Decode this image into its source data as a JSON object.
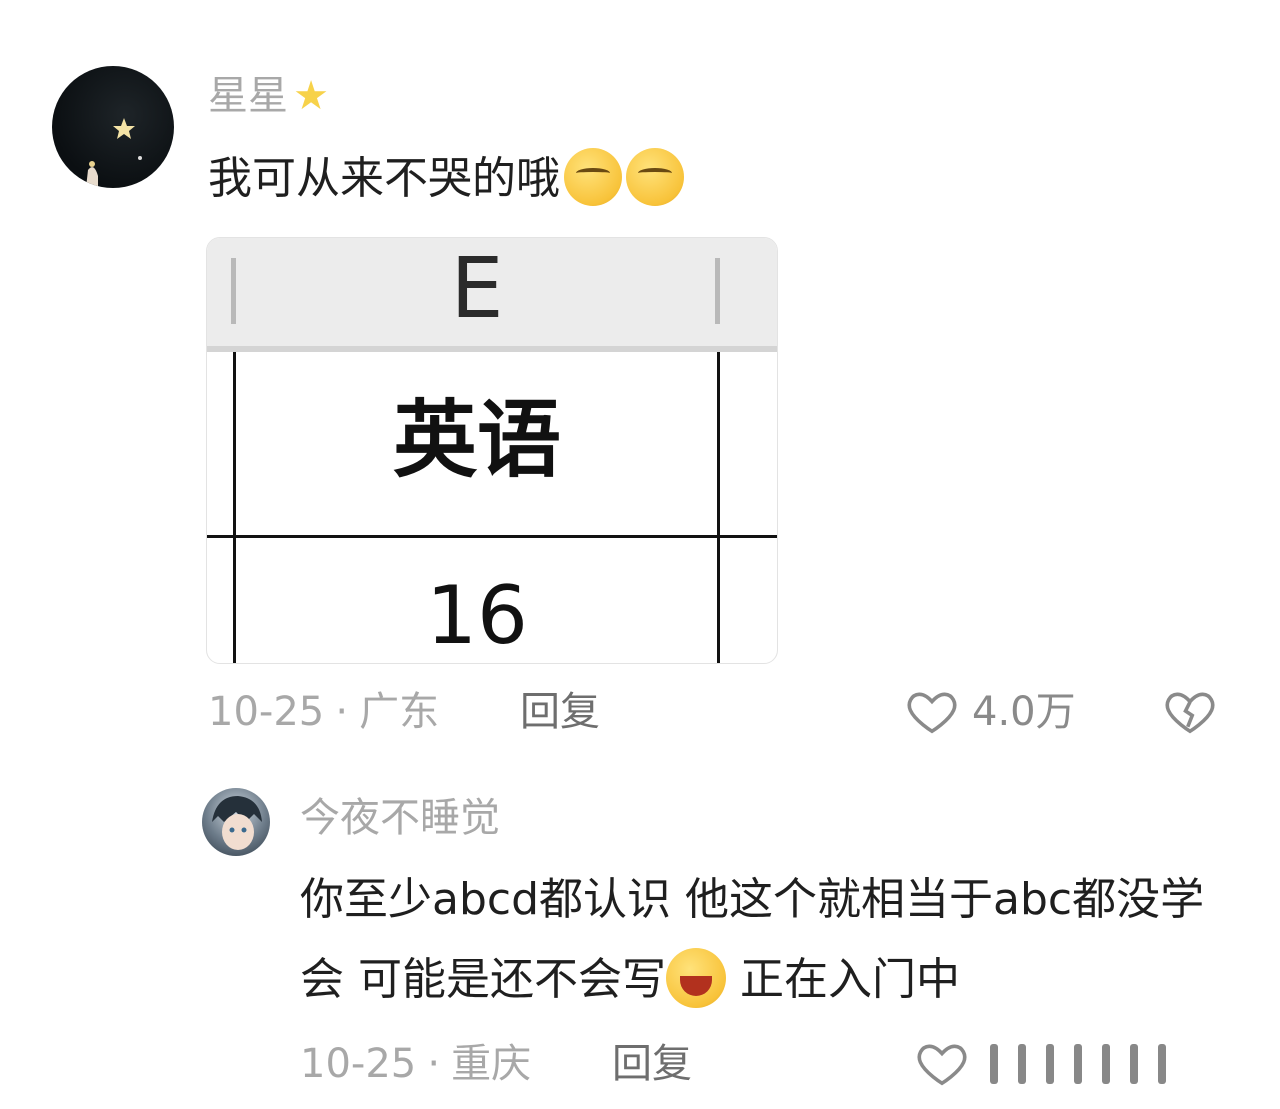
{
  "comment": {
    "username": "星星",
    "text": "我可从来不哭的哦",
    "emojis": [
      "smirk-emoji",
      "smirk-emoji"
    ],
    "image": {
      "column_header": "E",
      "cell_label": "英语",
      "cell_value": "16"
    },
    "date": "10-25",
    "separator": "·",
    "location": "广东",
    "reply_label": "回复",
    "like_count": "4.0万"
  },
  "reply": {
    "username": "今夜不睡觉",
    "text_part1": "你至少abcd都认识 他这个就相当于abc都没学会  可能是还不会写",
    "text_part2": " 正在入门中",
    "date": "10-25",
    "separator": "·",
    "location": "重庆",
    "reply_label": "回复"
  },
  "colors": {
    "username": "#a8a8a8",
    "text": "#1f1f1f",
    "meta": "#a8a8a8",
    "star": "#f7d24a"
  }
}
